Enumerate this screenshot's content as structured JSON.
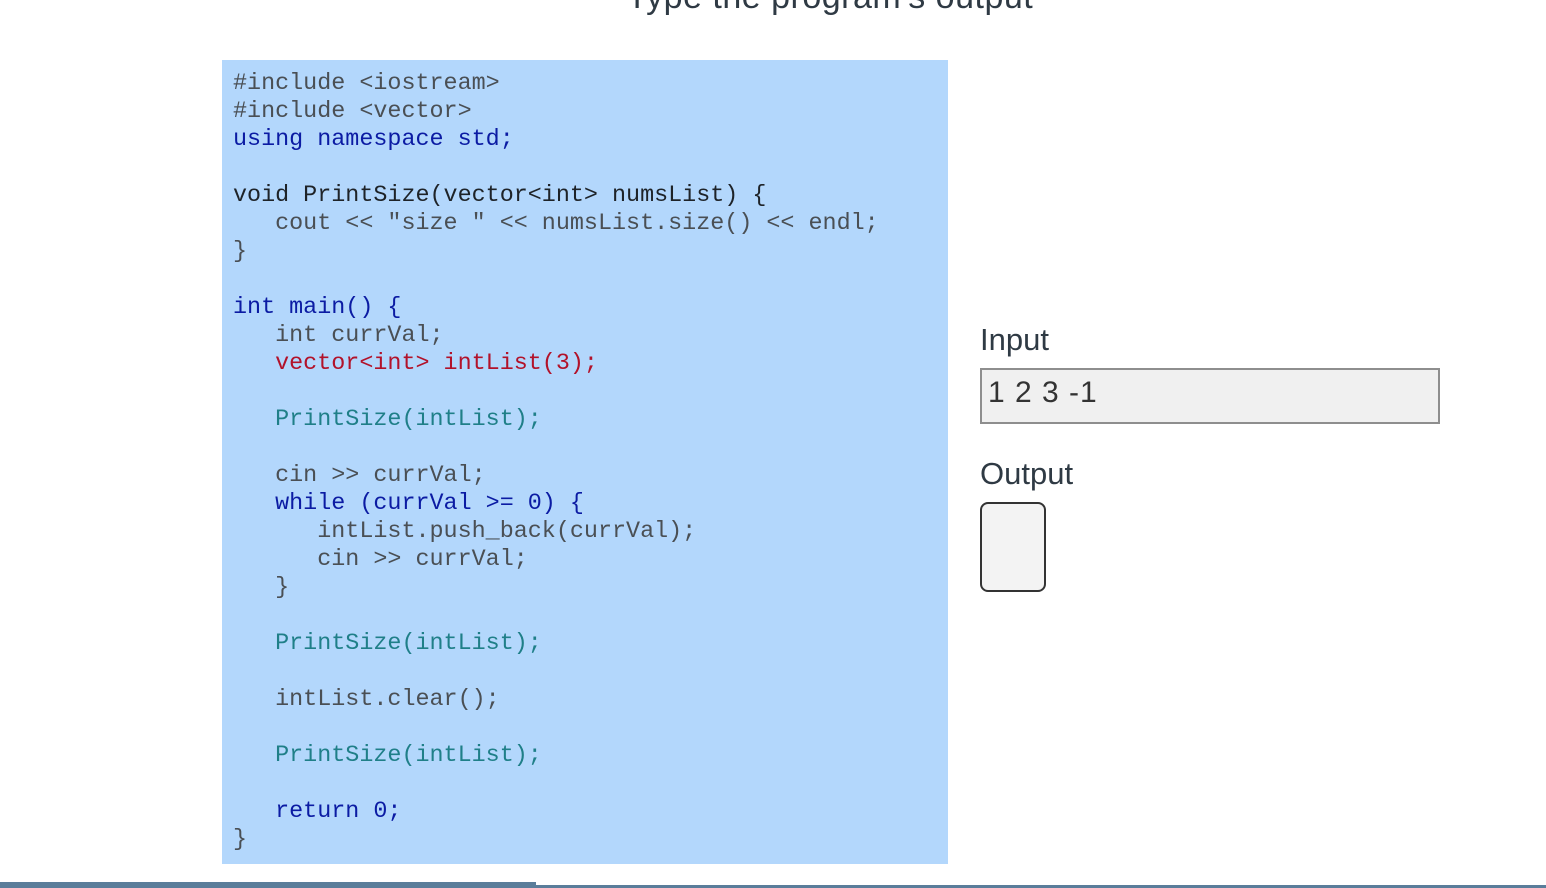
{
  "header": {
    "title": "Type the program's output"
  },
  "code": {
    "lines": [
      "#include <iostream>",
      "#include <vector>",
      "using namespace std;",
      "",
      "void PrintSize(vector<int> numsList) {",
      "   cout << \"size \" << numsList.size() << endl;",
      "}",
      "",
      "int main() {",
      "   int currVal;",
      "   vector<int> intList(3);",
      "",
      "   PrintSize(intList);",
      "",
      "   cin >> currVal;",
      "   while (currVal >= 0) {",
      "      intList.push_back(currVal);",
      "      cin >> currVal;",
      "   }",
      "",
      "   PrintSize(intList);",
      "",
      "   intList.clear();",
      "",
      "   PrintSize(intList);",
      "",
      "   return 0;",
      "}"
    ]
  },
  "io": {
    "input_label": "Input",
    "input_value": "1 2 3 -1",
    "output_label": "Output",
    "output_value": ""
  },
  "progress": {
    "fraction": 0.347
  },
  "colors": {
    "code_background": "#b3d7fc",
    "keyword": "#0b1ba3",
    "function": "#1f8a6a",
    "string": "#b1620e",
    "progress": "#5a7d9a"
  }
}
